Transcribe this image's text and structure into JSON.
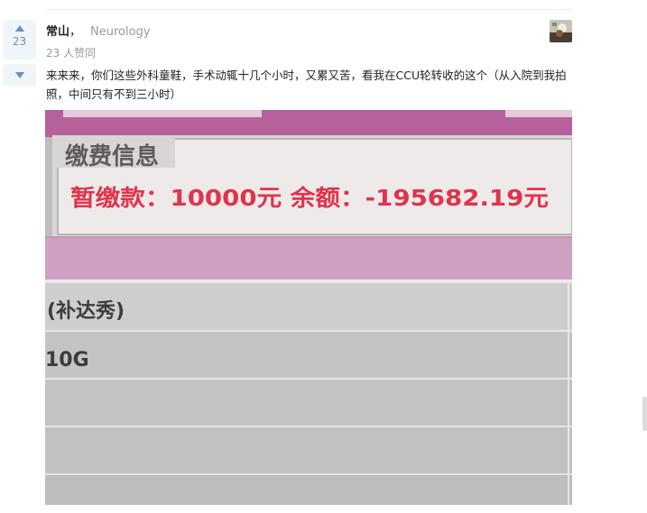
{
  "answer": {
    "vote_count": "23",
    "author": {
      "name": "常山",
      "separator": "，",
      "bio": "Neurology"
    },
    "votes_text": "23 人赞同",
    "body": "来来来，你们这些外科童鞋，手术动辄十几个小时，又累又苦，看我在CCU轮转收的这个（从入院到我拍照，中间只有不到三小时）",
    "photo": {
      "panel_title": "缴费信息",
      "payment_line": "暂缴款：10000元 余额：-195682.19元",
      "row1": "(补达秀)",
      "row2": "10G"
    }
  },
  "colors": {
    "vote_blue": "#698ebf",
    "vote_bg": "#eff6fa",
    "photo_red": "#e0344c",
    "photo_purple": "#a0457f"
  },
  "icons": {
    "upvote": "triangle-up",
    "downvote": "triangle-down"
  }
}
